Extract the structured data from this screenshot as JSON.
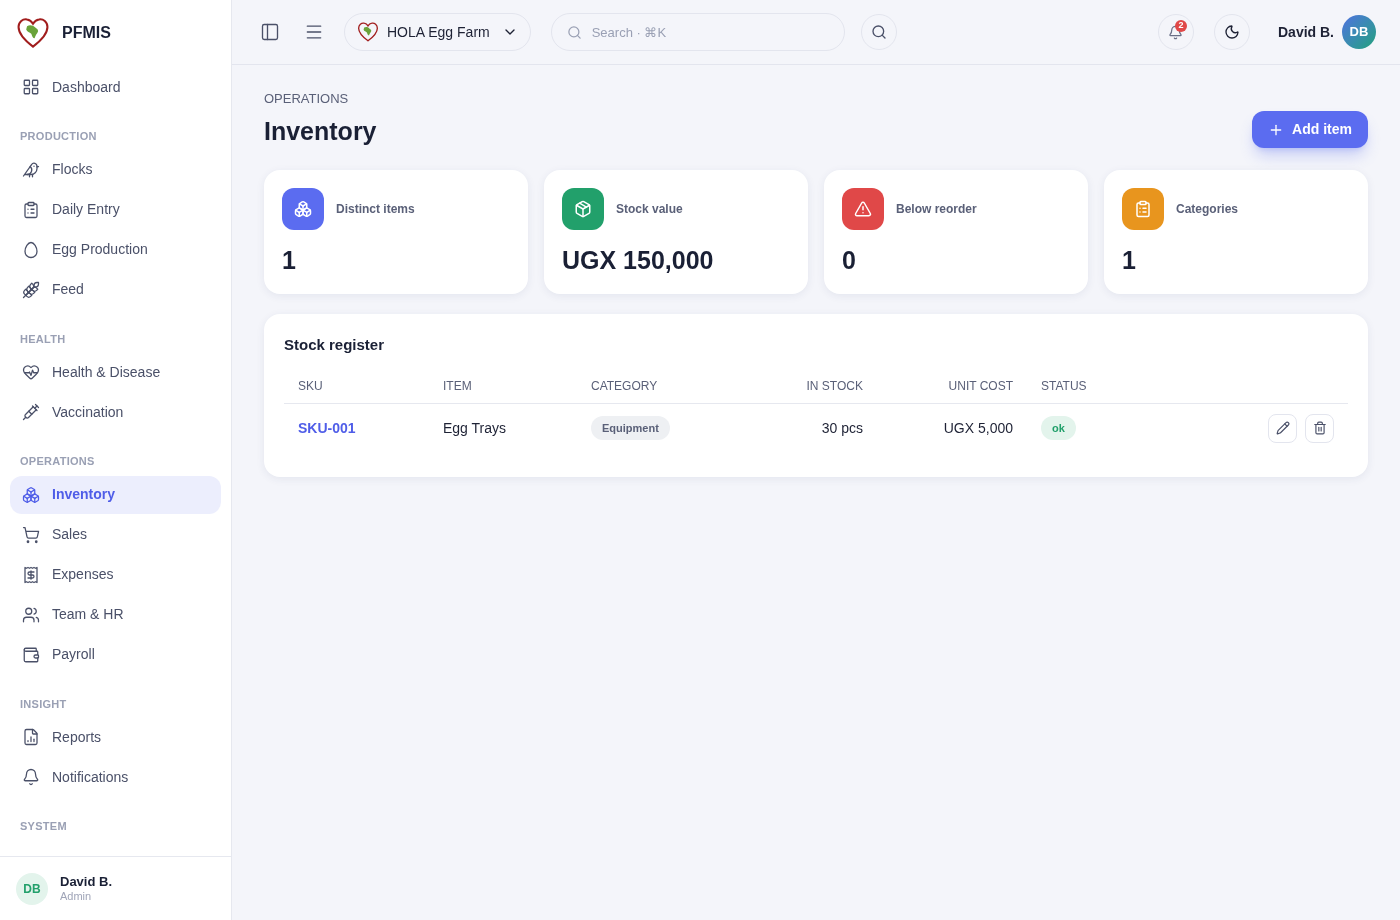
{
  "brand": {
    "name": "PFMIS"
  },
  "sidebar": {
    "sections": [
      {
        "items": [
          {
            "label": "Dashboard",
            "selected": false
          }
        ]
      },
      {
        "title": "PRODUCTION",
        "items": [
          {
            "label": "Flocks",
            "selected": false
          },
          {
            "label": "Daily Entry",
            "selected": false
          },
          {
            "label": "Egg Production",
            "selected": false
          },
          {
            "label": "Feed",
            "selected": false
          }
        ]
      },
      {
        "title": "HEALTH",
        "items": [
          {
            "label": "Health & Disease",
            "selected": false
          },
          {
            "label": "Vaccination",
            "selected": false
          }
        ]
      },
      {
        "title": "OPERATIONS",
        "items": [
          {
            "label": "Inventory",
            "selected": true
          },
          {
            "label": "Sales",
            "selected": false
          },
          {
            "label": "Expenses",
            "selected": false
          },
          {
            "label": "Team & HR",
            "selected": false
          },
          {
            "label": "Payroll",
            "selected": false
          }
        ]
      },
      {
        "title": "INSIGHT",
        "items": [
          {
            "label": "Reports",
            "selected": false
          },
          {
            "label": "Notifications",
            "selected": false
          }
        ]
      },
      {
        "title": "SYSTEM"
      }
    ],
    "user": {
      "initials": "DB",
      "name": "David B.",
      "role": "Admin"
    }
  },
  "topbar": {
    "farm": "HOLA Egg Farm",
    "search": {
      "placeholder": "Search · ⌘K"
    },
    "notification_count": "2",
    "user": {
      "name": "David B.",
      "initials": "DB"
    }
  },
  "page": {
    "breadcrumb": "OPERATIONS",
    "title": "Inventory",
    "add_button": "Add item"
  },
  "stats": [
    {
      "label": "Distinct items",
      "value": "1",
      "color": "#5b6cf0"
    },
    {
      "label": "Stock value",
      "value": "UGX 150,000",
      "color": "#22a06b"
    },
    {
      "label": "Below reorder",
      "value": "0",
      "color": "#e04848"
    },
    {
      "label": "Categories",
      "value": "1",
      "color": "#e8951e"
    }
  ],
  "table": {
    "title": "Stock register",
    "columns": [
      "SKU",
      "ITEM",
      "CATEGORY",
      "IN STOCK",
      "UNIT COST",
      "STATUS"
    ],
    "rows": [
      {
        "sku": "SKU-001",
        "item": "Egg Trays",
        "category": "Equipment",
        "in_stock": "30 pcs",
        "unit_cost": "UGX 5,000",
        "status": "ok"
      }
    ]
  }
}
